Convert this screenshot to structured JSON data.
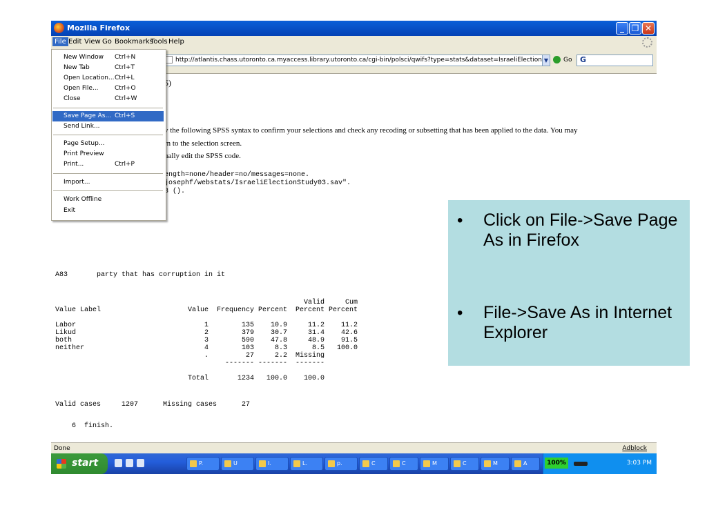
{
  "window": {
    "title": "Mozilla Firefox",
    "menus": [
      "File",
      "Edit",
      "View",
      "Go",
      "Bookmarks",
      "Tools",
      "Help"
    ],
    "url": "http://atlantis.chass.utoronto.ca.myaccess.library.utoronto.ca/cgi-bin/polsci/qwifs?type=stats&dataset=IsraeliElectionStu",
    "go_label": "Go",
    "status": "Done",
    "adblock": "Adblock"
  },
  "file_menu": {
    "items": [
      {
        "label": "New Window",
        "shortcut": "Ctrl+N"
      },
      {
        "label": "New Tab",
        "shortcut": "Ctrl+T"
      },
      {
        "label": "Open Location...",
        "shortcut": "Ctrl+L"
      },
      {
        "label": "Open File...",
        "shortcut": "Ctrl+O"
      },
      {
        "label": "Close",
        "shortcut": "Ctrl+W"
      },
      {
        "label": "Save Page As...",
        "shortcut": "Ctrl+S",
        "highlighted": true
      },
      {
        "label": "Send Link...",
        "shortcut": ""
      },
      {
        "label": "Page Setup...",
        "shortcut": ""
      },
      {
        "label": "Print Preview",
        "shortcut": ""
      },
      {
        "label": "Print...",
        "shortcut": "Ctrl+P"
      },
      {
        "label": "Import...",
        "shortcut": ""
      },
      {
        "label": "Work Offline",
        "shortcut": ""
      },
      {
        "label": "Exit",
        "shortcut": ""
      }
    ]
  },
  "page": {
    "fragment_top": "5)",
    "intro_1": "v the following SPSS syntax to confirm your selections and check any recoding or subsetting that has been applied to the data. You may",
    "intro_2": "rn to the selection screen.",
    "intro_3": "ually edit the SPSS code.",
    "syntax_1": "ength=none/header=no/messages=none.",
    "syntax_2": "josephf/webstats/IsraeliElectionStudy03.sav\".",
    "syntax_3": "3 ().",
    "variable_line": "A83       party that has corruption in it",
    "header_row1": [
      "",
      "",
      "",
      "",
      "Valid",
      "Cum"
    ],
    "header_row2": [
      "Value Label",
      "Value",
      "Frequency",
      "Percent",
      "Percent",
      "Percent"
    ],
    "rows": [
      [
        "Labor",
        "1",
        "135",
        "10.9",
        "11.2",
        "11.2"
      ],
      [
        "Likud",
        "2",
        "379",
        "30.7",
        "31.4",
        "42.6"
      ],
      [
        "both",
        "3",
        "590",
        "47.8",
        "48.9",
        "91.5"
      ],
      [
        "neither",
        "4",
        "103",
        "8.3",
        "8.5",
        "100.0"
      ],
      [
        "",
        ".",
        "27",
        "2.2",
        "Missing",
        ""
      ]
    ],
    "divider": [
      "",
      "",
      "-------",
      "-------",
      "-------",
      ""
    ],
    "total_row": [
      "",
      "Total",
      "1234",
      "100.0",
      "100.0",
      ""
    ],
    "valid_cases_line": "Valid cases     1207      Missing cases      27",
    "finish_line": "6  finish."
  },
  "taskbar": {
    "start": "start",
    "buttons": [
      "P.",
      "U",
      "I.",
      "L.",
      "p.",
      "C",
      "C",
      "M",
      "C",
      "M",
      "A"
    ],
    "battery": "100%",
    "clock": "3:03 PM"
  },
  "callout": {
    "bullets": [
      "Click on File->Save Page As in Firefox",
      "File->Save As in Internet Explorer"
    ]
  }
}
